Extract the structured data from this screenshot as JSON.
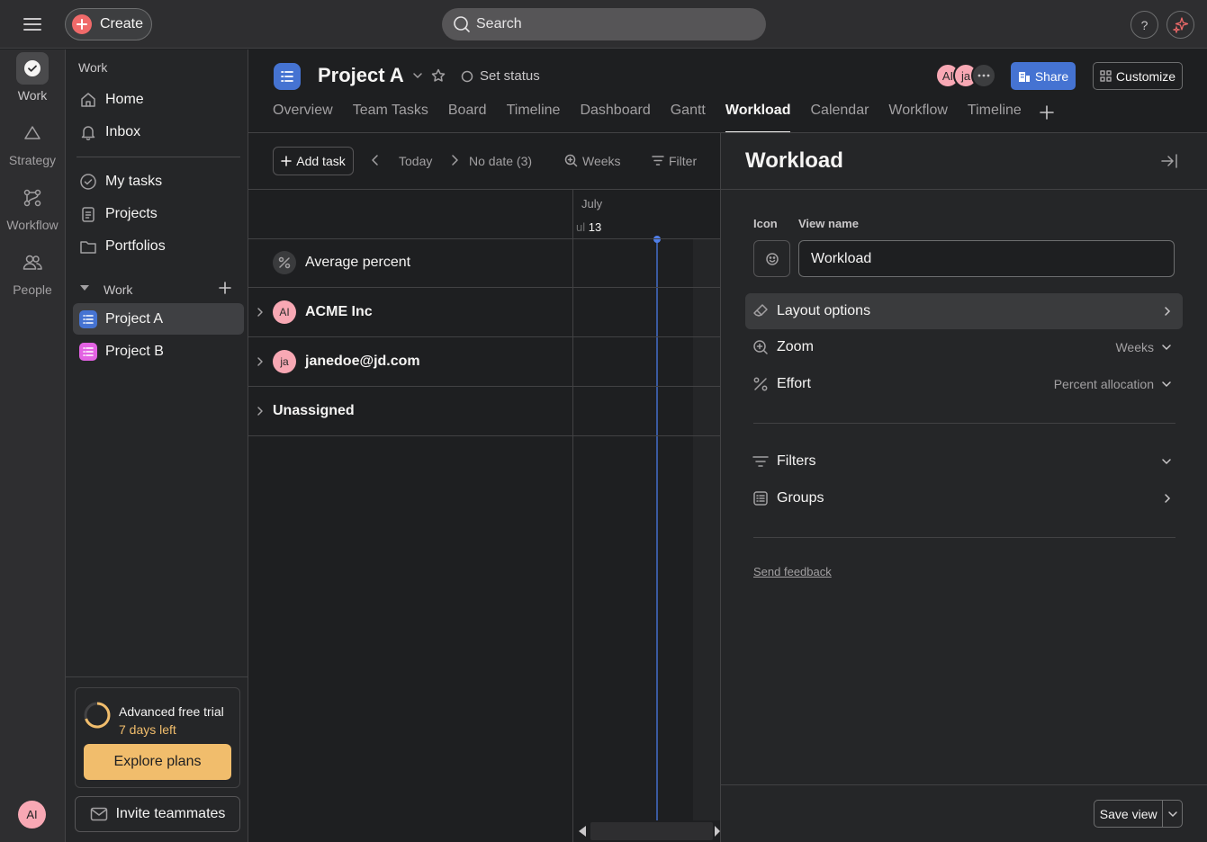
{
  "topbar": {
    "create_label": "Create",
    "search_placeholder": "Search",
    "help_label": "?"
  },
  "rail": {
    "items": [
      {
        "label": "Work",
        "icon": "check-circle-icon"
      },
      {
        "label": "Strategy",
        "icon": "triangle-icon"
      },
      {
        "label": "Workflow",
        "icon": "workflow-icon"
      },
      {
        "label": "People",
        "icon": "people-icon"
      }
    ],
    "user_initials": "AI"
  },
  "sidebar": {
    "section_work": "Work",
    "nav": [
      {
        "label": "Home",
        "icon": "home-icon"
      },
      {
        "label": "Inbox",
        "icon": "bell-icon"
      }
    ],
    "nav2": [
      {
        "label": "My tasks",
        "icon": "check-circle-icon"
      },
      {
        "label": "Projects",
        "icon": "clipboard-icon"
      },
      {
        "label": "Portfolios",
        "icon": "folder-icon"
      }
    ],
    "team_label": "Work",
    "projects": [
      {
        "label": "Project A",
        "color": "#4573d2"
      },
      {
        "label": "Project B",
        "color": "#e362e3"
      }
    ],
    "trial_title": "Advanced free trial",
    "trial_days": "7 days left",
    "explore_label": "Explore plans",
    "invite_label": "Invite teammates"
  },
  "project": {
    "title": "Project A",
    "set_status": "Set status",
    "members": [
      "AI",
      "ja"
    ],
    "share_label": "Share",
    "customize_label": "Customize",
    "tabs": [
      "Overview",
      "Team Tasks",
      "Board",
      "Timeline",
      "Dashboard",
      "Gantt",
      "Workload",
      "Calendar",
      "Workflow",
      "Timeline"
    ],
    "active_tab": "Workload"
  },
  "toolbar": {
    "add_task": "Add task",
    "today": "Today",
    "no_date": "No date (3)",
    "weeks": "Weeks",
    "filter": "Filter"
  },
  "grid": {
    "month": "July",
    "date_prefix": "ul",
    "date_day": "13",
    "rows": [
      {
        "label": "Average percent",
        "type": "percent"
      },
      {
        "label": "ACME Inc",
        "avatar": "AI"
      },
      {
        "label": "janedoe@jd.com",
        "avatar": "ja"
      },
      {
        "label": "Unassigned"
      }
    ]
  },
  "panel": {
    "title": "Workload",
    "icon_label": "Icon",
    "view_name_label": "View name",
    "view_name_value": "Workload",
    "layout_options": "Layout options",
    "zoom_label": "Zoom",
    "zoom_value": "Weeks",
    "effort_label": "Effort",
    "effort_value": "Percent allocation",
    "filters_label": "Filters",
    "groups_label": "Groups",
    "send_feedback": "Send feedback",
    "save_view": "Save view"
  }
}
